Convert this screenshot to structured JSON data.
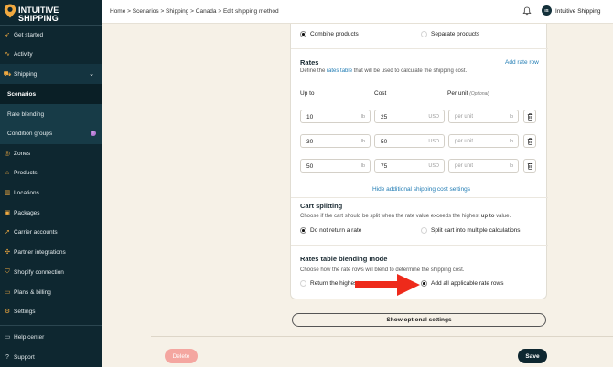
{
  "brand": {
    "line1": "INTUITIVE",
    "line2": "SHIPPING",
    "accent": "#f0a940",
    "sidebar_bg": "#0e2730"
  },
  "sidebar": {
    "items": [
      {
        "label": "Get started",
        "icon": "rocket-icon"
      },
      {
        "label": "Activity",
        "icon": "activity-icon"
      },
      {
        "label": "Shipping",
        "icon": "truck-icon"
      },
      {
        "label": "Scenarios"
      },
      {
        "label": "Rate blending"
      },
      {
        "label": "Condition groups",
        "badge": "!"
      },
      {
        "label": "Zones",
        "icon": "globe-icon"
      },
      {
        "label": "Products",
        "icon": "tag-icon"
      },
      {
        "label": "Locations",
        "icon": "building-icon"
      },
      {
        "label": "Packages",
        "icon": "box-icon"
      },
      {
        "label": "Carrier accounts",
        "icon": "carrier-icon"
      },
      {
        "label": "Partner integrations",
        "icon": "plug-icon"
      },
      {
        "label": "Shopify connection",
        "icon": "shop-icon"
      },
      {
        "label": "Plans & billing",
        "icon": "card-icon"
      },
      {
        "label": "Settings",
        "icon": "gear-icon"
      },
      {
        "label": "Help center",
        "icon": "help-icon"
      },
      {
        "label": "Support",
        "icon": "support-icon"
      }
    ]
  },
  "topbar": {
    "breadcrumb": "Home > Scenarios > Shipping > Canada > Edit shipping method",
    "avatar_initials": "IS",
    "user_name": "Intuitive Shipping"
  },
  "card": {
    "combine": {
      "combine_label": "Combine products",
      "separate_label": "Separate products"
    },
    "rates": {
      "title": "Rates",
      "add_link": "Add rate row",
      "desc_prefix": "Define the ",
      "desc_link": "rates table",
      "desc_suffix": " that will be used to calculate the shipping cost.",
      "col_upto": "Up to",
      "col_cost": "Cost",
      "col_perunit": "Per unit",
      "col_optional": "(Optional)",
      "rows": [
        {
          "upto": "10",
          "upto_unit": "lb",
          "cost": "25",
          "cost_unit": "USD",
          "perunit_placeholder": "per unit",
          "perunit_unit": "lb"
        },
        {
          "upto": "30",
          "upto_unit": "lb",
          "cost": "50",
          "cost_unit": "USD",
          "perunit_placeholder": "per unit",
          "perunit_unit": "lb"
        },
        {
          "upto": "50",
          "upto_unit": "lb",
          "cost": "75",
          "cost_unit": "USD",
          "perunit_placeholder": "per unit",
          "perunit_unit": "lb"
        }
      ],
      "hide_link": "Hide additional shipping cost settings"
    },
    "cart_splitting": {
      "title": "Cart splitting",
      "desc_prefix": "Choose if the cart should be split when the rate value exceeds the highest ",
      "desc_bold": "up to",
      "desc_suffix": " value.",
      "opt1": "Do not return a rate",
      "opt2": "Split cart into multiple calculations"
    },
    "blending": {
      "title": "Rates table blending mode",
      "desc": "Choose how the rate rows will blend to determine the shipping cost.",
      "opt1": "Return the highest",
      "opt2": "Add all applicable rate rows"
    }
  },
  "optional_settings_label": "Show optional settings",
  "footer": {
    "delete_label": "Delete",
    "save_label": "Save"
  }
}
